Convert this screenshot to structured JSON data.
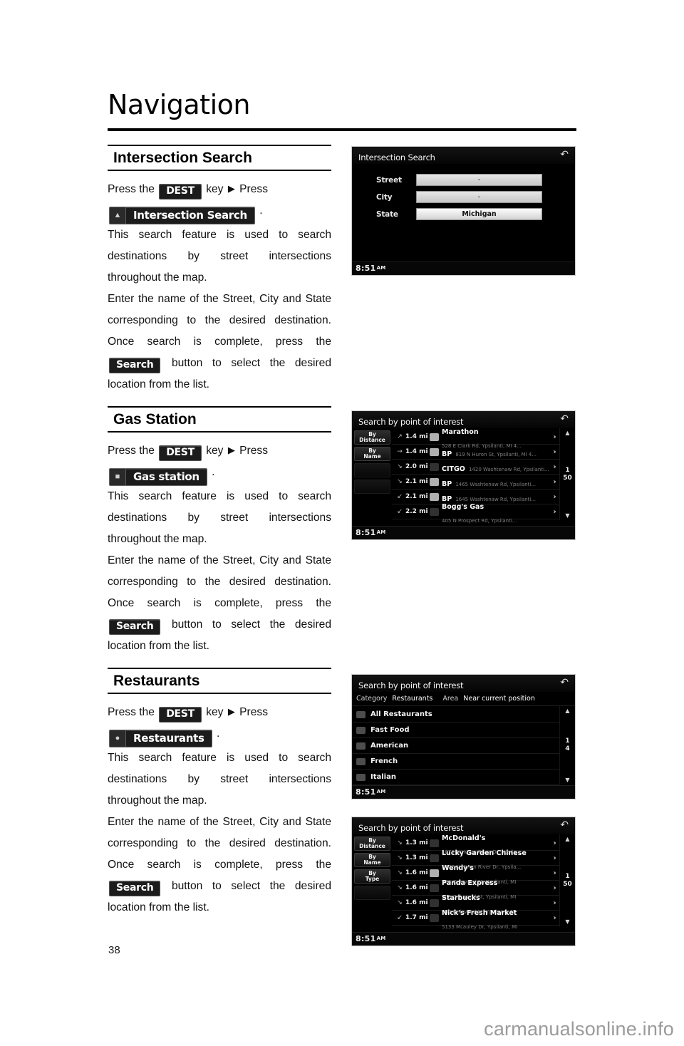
{
  "page": {
    "title": "Navigation",
    "number": "38",
    "watermark": "carmanualsonline.info"
  },
  "sections": [
    {
      "heading": "Intersection Search",
      "press_prefix": "Press the",
      "dest_key": "DEST",
      "key_word": "key",
      "press_word": "Press",
      "menu_chip": "Intersection Search",
      "menu_chip_icon": "intersection-icon",
      "body1": "This search feature is used to search destinations by street intersections throughout the map.",
      "body2_a": "Enter the name of the Street, City and State corresponding to the desired destination. Once search is complete, press the",
      "search_chip": "Search",
      "body2_b": "button to select the desired location from the list."
    },
    {
      "heading": "Gas Station",
      "press_prefix": "Press the",
      "dest_key": "DEST",
      "key_word": "key",
      "press_word": "Press",
      "menu_chip": "Gas station",
      "menu_chip_icon": "fuel-pump-icon",
      "body1": "This search feature is used to search destinations by street intersections throughout the map.",
      "body2_a": "Enter the name of the Street, City and State corresponding to the desired destination. Once search is complete, press the",
      "search_chip": "Search",
      "body2_b": "button to select the desired location from the list."
    },
    {
      "heading": "Restaurants",
      "press_prefix": "Press the",
      "dest_key": "DEST",
      "key_word": "key",
      "press_word": "Press",
      "menu_chip": "Restaurants",
      "menu_chip_icon": "cutlery-icon",
      "body1": "This search feature is used to search destinations by street intersections throughout the map.",
      "body2_a": "Enter the name of the Street, City and State corresponding to the desired destination. Once search is complete, press the",
      "search_chip": "Search",
      "body2_b": "button to select the desired location from the list."
    }
  ],
  "screens": {
    "intersection": {
      "title": "Intersection Search",
      "back_icon": "back-arrow-icon",
      "clock": "8:51",
      "clock_ampm": "AM",
      "fields": [
        {
          "label": "Street",
          "value": "-",
          "empty": true
        },
        {
          "label": "City",
          "value": "-",
          "empty": true
        },
        {
          "label": "State",
          "value": "Michigan",
          "empty": false
        }
      ]
    },
    "gas": {
      "title": "Search by point of interest",
      "back_icon": "back-arrow-icon",
      "clock": "8:51",
      "clock_ampm": "AM",
      "sort_buttons": [
        {
          "label": "By\nDistance",
          "dim": false
        },
        {
          "label": "By\nName",
          "dim": false
        },
        {
          "label": "",
          "dim": true
        },
        {
          "label": "",
          "dim": true
        }
      ],
      "page_current": "1",
      "page_total": "50",
      "scroll_up_icon": "triangle-up-icon",
      "scroll_down_icon": "triangle-down-icon",
      "rows": [
        {
          "dir": "↗",
          "dist": "1.4 mi",
          "name": "Marathon",
          "addr": "528 E Clark Rd, Ypsilanti, MI 4...",
          "brand": true
        },
        {
          "dir": "→",
          "dist": "1.4 mi",
          "name": "BP",
          "addr": "819 N Huron St, Ypsilanti, MI 4...",
          "brand": true
        },
        {
          "dir": "↘",
          "dist": "2.0 mi",
          "name": "CITGO",
          "addr": "1420 Washtenaw Rd, Ypsilanti...",
          "brand": false
        },
        {
          "dir": "↘",
          "dist": "2.1 mi",
          "name": "BP",
          "addr": "1465 Washtenaw Rd, Ypsilanti...",
          "brand": true
        },
        {
          "dir": "↙",
          "dist": "2.1 mi",
          "name": "BP",
          "addr": "1645 Washtenaw Rd, Ypsilanti...",
          "brand": true
        },
        {
          "dir": "↙",
          "dist": "2.2 mi",
          "name": "Bogg's Gas",
          "addr": "405 N Prospect Rd, Ypsilanti...",
          "brand": false
        }
      ]
    },
    "restaurant_categories": {
      "title": "Search by point of interest",
      "back_icon": "back-arrow-icon",
      "clock": "8:51",
      "clock_ampm": "AM",
      "category_key": "Category",
      "category_value": "Restaurants",
      "area_key": "Area",
      "area_value": "Near current position",
      "page_current": "1",
      "page_total": "4",
      "scroll_up_icon": "triangle-up-icon",
      "scroll_down_icon": "triangle-down-icon",
      "rows": [
        {
          "label": "All Restaurants"
        },
        {
          "label": "Fast Food"
        },
        {
          "label": "American"
        },
        {
          "label": "French"
        },
        {
          "label": "Italian"
        }
      ]
    },
    "restaurant_results": {
      "title": "Search by point of interest",
      "back_icon": "back-arrow-icon",
      "clock": "8:51",
      "clock_ampm": "AM",
      "sort_buttons": [
        {
          "label": "By\nDistance",
          "dim": false
        },
        {
          "label": "By\nName",
          "dim": false
        },
        {
          "label": "By\nType",
          "dim": false
        },
        {
          "label": "",
          "dim": true
        }
      ],
      "page_current": "1",
      "page_total": "50",
      "scroll_up_icon": "triangle-up-icon",
      "scroll_down_icon": "triangle-down-icon",
      "rows": [
        {
          "dir": "↘",
          "dist": "1.3 mi",
          "name": "McDonald's",
          "addr": "1070 N Huron River Dr, Ypsila...",
          "brand": false
        },
        {
          "dir": "↘",
          "dist": "1.3 mi",
          "name": "Lucky Garden Chinese",
          "addr": "1072 N Huron River Dr, Ypsila...",
          "brand": false
        },
        {
          "dir": "↘",
          "dist": "1.6 mi",
          "name": "Wendy's",
          "addr": "900 Oakwood St, Ypsilanti, MI",
          "brand": true
        },
        {
          "dir": "↘",
          "dist": "1.6 mi",
          "name": "Panda Express",
          "addr": "900 Oakwood St, Ypsilanti, MI",
          "brand": false
        },
        {
          "dir": "↘",
          "dist": "1.6 mi",
          "name": "Starbucks",
          "addr": "900 Oakwood St, Ypsilanti, MI",
          "brand": false
        },
        {
          "dir": "↙",
          "dist": "1.7 mi",
          "name": "Nick's Fresh Market",
          "addr": "5133 Mcauley Dr, Ypsilanti, MI",
          "brand": false
        }
      ]
    }
  }
}
